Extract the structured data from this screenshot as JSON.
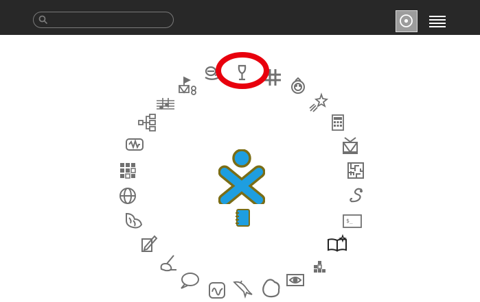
{
  "toolbar": {
    "search": {
      "value": "",
      "placeholder": "",
      "icon": "search-icon"
    },
    "views": [
      {
        "name": "ring-view",
        "icon": "ring-view-icon",
        "selected": true
      },
      {
        "name": "list-view",
        "icon": "list-view-icon",
        "selected": false
      }
    ]
  },
  "ring": {
    "activities": [
      {
        "name": "turtle-art",
        "icon": "turtle-art-icon"
      },
      {
        "name": "browse",
        "icon": "browse-icon"
      },
      {
        "name": "tamtam-edit",
        "icon": "tamtam-edit-icon"
      },
      {
        "name": "music-sequencer",
        "icon": "music-sequencer-icon"
      },
      {
        "name": "write",
        "icon": "write-icon"
      },
      {
        "name": "measure",
        "icon": "measure-icon"
      },
      {
        "name": "grid-tiles",
        "icon": "grid-tiles-icon"
      },
      {
        "name": "world-globe",
        "icon": "globe-icon"
      },
      {
        "name": "pippy",
        "icon": "pippy-icon"
      },
      {
        "name": "paint",
        "icon": "paint-icon"
      },
      {
        "name": "paint-brush",
        "icon": "paint-brush-icon"
      },
      {
        "name": "chat",
        "icon": "chat-icon"
      },
      {
        "name": "oscilloscope",
        "icon": "oscilloscope-icon"
      },
      {
        "name": "dolphin",
        "icon": "dolphin-icon"
      },
      {
        "name": "shape-blob",
        "icon": "blob-icon"
      },
      {
        "name": "image-viewer",
        "icon": "image-viewer-icon"
      },
      {
        "name": "blocks",
        "icon": "blocks-icon"
      },
      {
        "name": "read",
        "icon": "read-icon"
      },
      {
        "name": "terminal",
        "icon": "terminal-icon"
      },
      {
        "name": "snake",
        "icon": "snake-icon"
      },
      {
        "name": "maze",
        "icon": "maze-icon"
      },
      {
        "name": "tamtam-jam",
        "icon": "drum-icon"
      },
      {
        "name": "calculate",
        "icon": "calculator-icon"
      },
      {
        "name": "shooting-star",
        "icon": "star-icon"
      },
      {
        "name": "speak",
        "icon": "speak-icon"
      },
      {
        "name": "tic-tac-toe",
        "icon": "hash-icon"
      },
      {
        "name": "wine-glass",
        "icon": "wine-glass-icon"
      },
      {
        "name": "mind-map",
        "icon": "mind-map-icon"
      },
      {
        "name": "memorize",
        "icon": "memorize-icon"
      }
    ]
  },
  "highlight": {
    "color": "#e8000d",
    "target": "wine-glass"
  },
  "center": {
    "xo_icon": {
      "icon": "xo-user-icon",
      "stroke": "#7a6d16",
      "fill": "#1e9ee0"
    },
    "journal": {
      "icon": "journal-icon",
      "stroke": "#7a6d16",
      "fill": "#1e9ee0"
    }
  },
  "colors": {
    "toolbar": "#282828",
    "icons": "#707070",
    "read_icon": "#222222",
    "background": "#ffffff"
  }
}
